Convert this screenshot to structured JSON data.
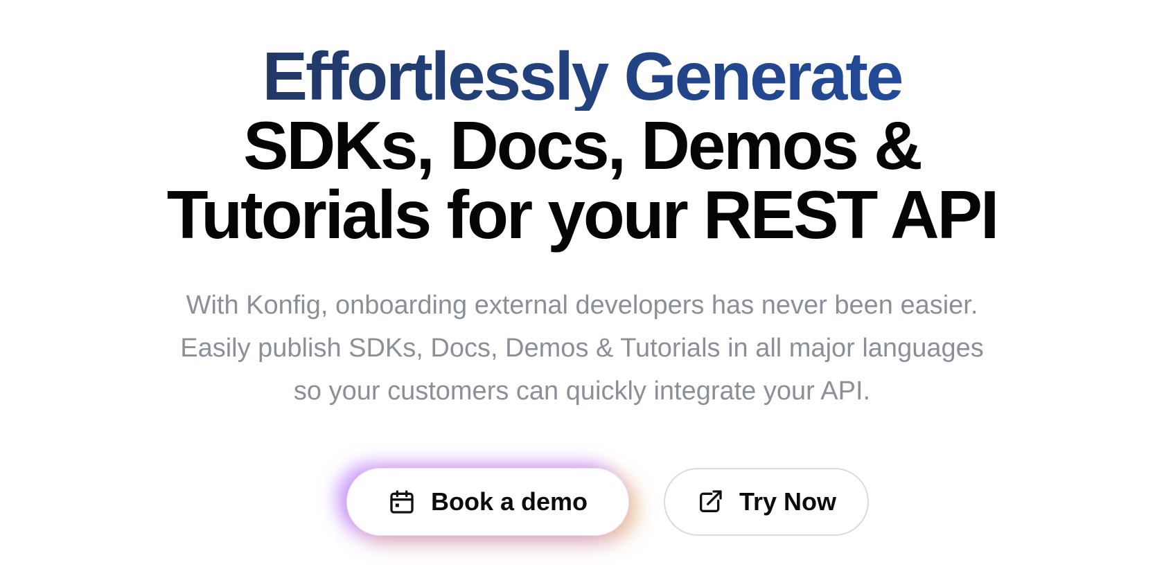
{
  "hero": {
    "headline": {
      "line1": "Effortlessly Generate",
      "line2": "SDKs, Docs, Demos &",
      "line3": "Tutorials for your REST API"
    },
    "subtitle": {
      "line1": "With Konfig, onboarding external developers has never been easier.",
      "line2": "Easily publish SDKs, Docs, Demos & Tutorials in all major languages",
      "line3": "so your customers can quickly integrate your API."
    },
    "buttons": {
      "book_demo": {
        "label": "Book a demo",
        "icon": "calendar-icon"
      },
      "try_now": {
        "label": "Try Now",
        "icon": "external-link-icon"
      }
    }
  },
  "colors": {
    "headline_gradient_start": "#233251",
    "headline_gradient_end": "#2451ad",
    "headline_text": "#050505",
    "subtitle_text": "#8a8f98",
    "glow_purple": "#a855f7",
    "glow_amber": "#eab364",
    "button_border": "#d7dae0"
  }
}
